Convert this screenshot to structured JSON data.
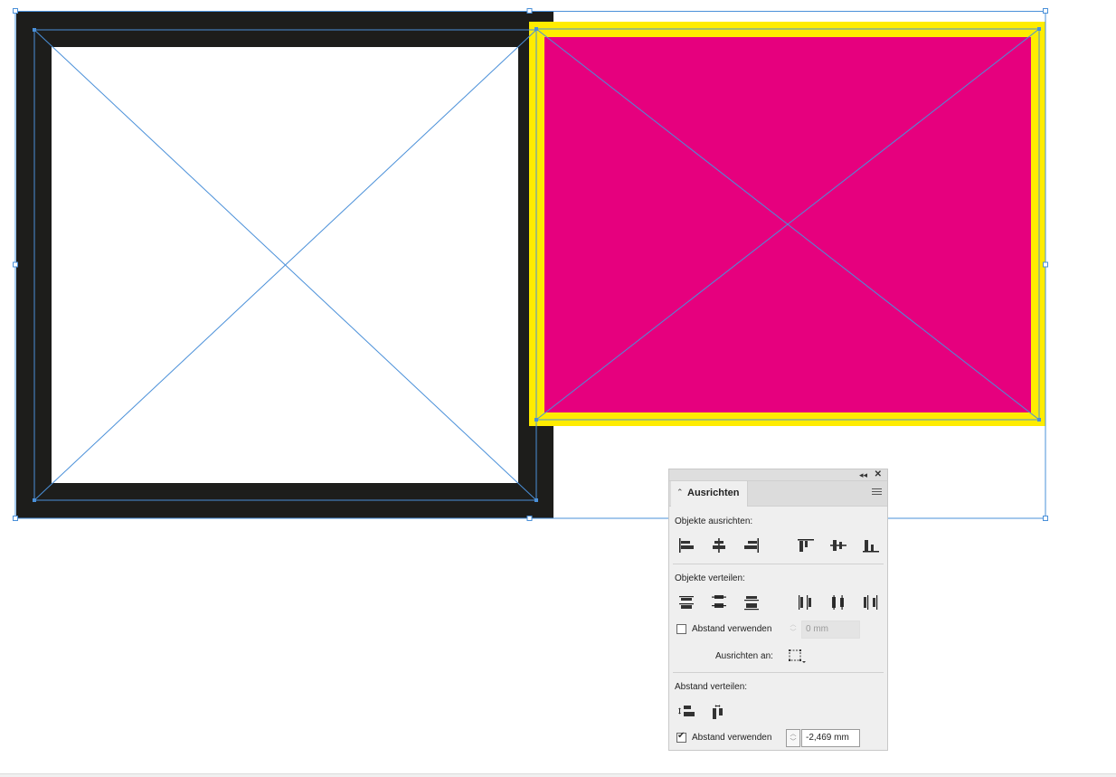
{
  "canvas": {
    "frame_left": {
      "fill": "#ffffff",
      "stroke": "#1d1d1b"
    },
    "frame_right": {
      "fill": "#e6007e",
      "stroke": "#ffec00"
    },
    "guide_color": "#4a90d9"
  },
  "panel": {
    "title": "Ausrichten",
    "align_objects_label": "Objekte ausrichten:",
    "distribute_objects_label": "Objekte verteilen:",
    "use_spacing_1_label": "Abstand verwenden",
    "use_spacing_1_checked": false,
    "use_spacing_1_value": "0 mm",
    "align_to_label": "Ausrichten an:",
    "distribute_spacing_label": "Abstand verteilen:",
    "use_spacing_2_label": "Abstand verwenden",
    "use_spacing_2_checked": true,
    "use_spacing_2_value": "-2,469 mm",
    "icons": {
      "collapse": "double-chevron-left-icon",
      "close": "close-icon",
      "menu": "panel-menu-icon"
    }
  }
}
